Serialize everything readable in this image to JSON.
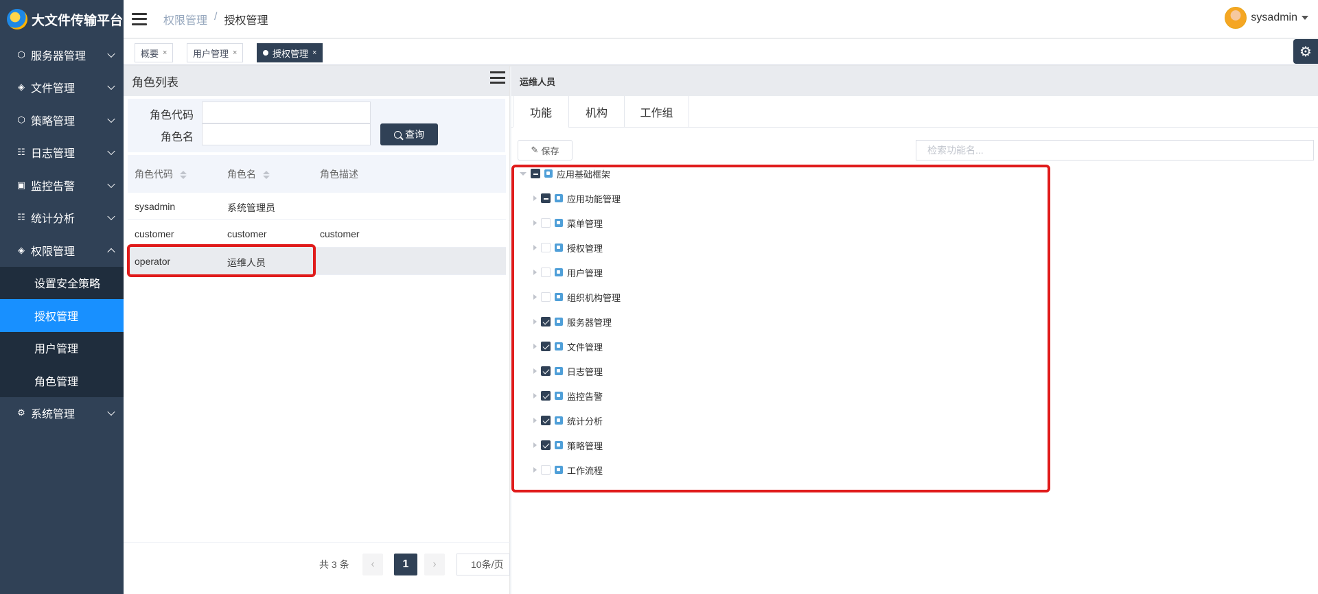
{
  "app": {
    "title": "大文件传输平台"
  },
  "sidebar": {
    "items": [
      {
        "label": "服务器管理",
        "icon": "server-icon",
        "expanded": false
      },
      {
        "label": "文件管理",
        "icon": "file-icon",
        "expanded": false
      },
      {
        "label": "策略管理",
        "icon": "strategy-icon",
        "expanded": false
      },
      {
        "label": "日志管理",
        "icon": "log-icon",
        "expanded": false
      },
      {
        "label": "监控告警",
        "icon": "monitor-icon",
        "expanded": false
      },
      {
        "label": "统计分析",
        "icon": "stats-icon",
        "expanded": false
      },
      {
        "label": "权限管理",
        "icon": "permission-icon",
        "expanded": true
      },
      {
        "label": "系统管理",
        "icon": "system-icon",
        "expanded": false
      }
    ],
    "sub_items": [
      {
        "label": "设置安全策略",
        "active": false
      },
      {
        "label": "授权管理",
        "active": true
      },
      {
        "label": "用户管理",
        "active": false
      },
      {
        "label": "角色管理",
        "active": false
      }
    ],
    "bg_color": "#304156",
    "active_color": "#1890ff"
  },
  "header": {
    "breadcrumb": [
      "权限管理",
      "授权管理"
    ],
    "separator": "/",
    "user": "sysadmin"
  },
  "tags": [
    {
      "label": "概要",
      "close": "×",
      "active": false
    },
    {
      "label": "用户管理",
      "close": "×",
      "active": false
    },
    {
      "label": "授权管理",
      "close": "×",
      "active": true
    }
  ],
  "left": {
    "title": "角色列表",
    "form": {
      "code_label": "角色代码",
      "code_value": "",
      "name_label": "角色名",
      "name_value": "",
      "query_label": "查询"
    },
    "columns": [
      "角色代码",
      "角色名",
      "角色描述"
    ],
    "rows": [
      {
        "code": "sysadmin",
        "name": "系统管理员",
        "desc": ""
      },
      {
        "code": "customer",
        "name": "customer",
        "desc": "customer"
      },
      {
        "code": "operator",
        "name": "运维人员",
        "desc": ""
      }
    ],
    "selected_row": 2,
    "pager": {
      "total": "共 3 条",
      "prev": "‹",
      "current": "1",
      "next": "›",
      "page_size": "10条/页"
    }
  },
  "right": {
    "role_title": "运维人员",
    "tabs": [
      "功能",
      "机构",
      "工作组"
    ],
    "active_tab": 0,
    "save_label": "保存",
    "search_placeholder": "检索功能名...",
    "tree": {
      "root": {
        "label": "应用基础框架",
        "state": "half"
      },
      "children": [
        {
          "label": "应用功能管理",
          "state": "half"
        },
        {
          "label": "菜单管理",
          "state": "unchecked"
        },
        {
          "label": "授权管理",
          "state": "unchecked"
        },
        {
          "label": "用户管理",
          "state": "unchecked"
        },
        {
          "label": "组织机构管理",
          "state": "unchecked"
        },
        {
          "label": "服务器管理",
          "state": "checked"
        },
        {
          "label": "文件管理",
          "state": "checked"
        },
        {
          "label": "日志管理",
          "state": "checked"
        },
        {
          "label": "监控告警",
          "state": "checked"
        },
        {
          "label": "统计分析",
          "state": "checked"
        },
        {
          "label": "策略管理",
          "state": "checked"
        },
        {
          "label": "工作流程",
          "state": "unchecked"
        }
      ]
    }
  },
  "highlight_color": "#e01b1b"
}
